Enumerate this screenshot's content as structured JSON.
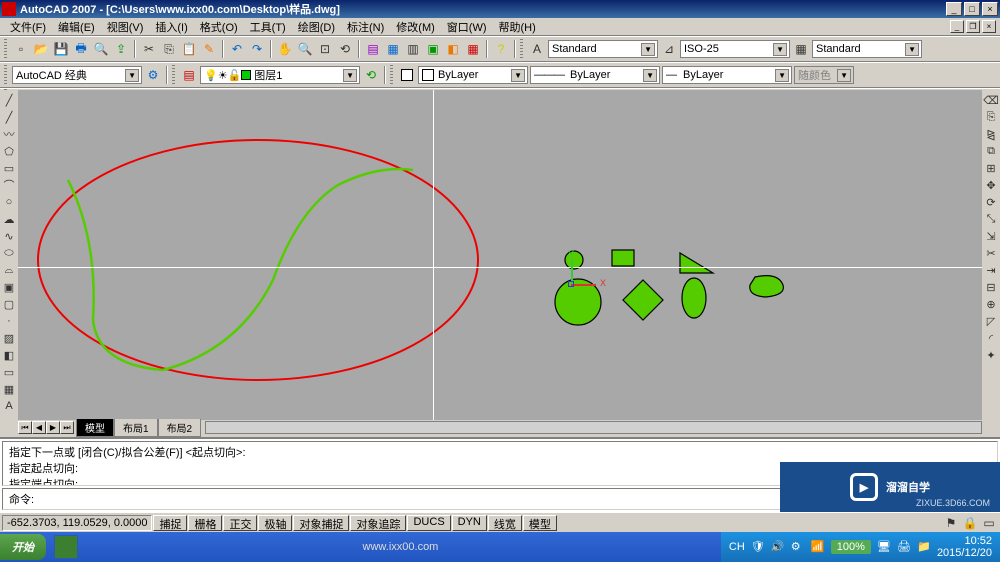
{
  "app": {
    "title": "AutoCAD 2007 - [C:\\Users\\www.ixx00.com\\Desktop\\样品.dwg]"
  },
  "menu": {
    "file": "文件(F)",
    "edit": "编辑(E)",
    "view": "视图(V)",
    "insert": "插入(I)",
    "format": "格式(O)",
    "tools": "工具(T)",
    "draw": "绘图(D)",
    "dimension": "标注(N)",
    "modify": "修改(M)",
    "window": "窗口(W)",
    "help": "帮助(H)"
  },
  "toolbar1": {
    "workspace": "AutoCAD 经典",
    "text_style": "Standard",
    "dim_style": "ISO-25",
    "table_style": "Standard"
  },
  "toolbar2": {
    "layer": "图层1",
    "color": "ByLayer",
    "linetype": "ByLayer",
    "lineweight": "ByLayer",
    "plotstyle": "随颜色"
  },
  "tabs": {
    "model": "模型",
    "layout1": "布局1",
    "layout2": "布局2"
  },
  "command": {
    "line1": "指定下一点或 [闭合(C)/拟合公差(F)] <起点切向>:",
    "line2": "指定起点切向:",
    "line3": "指定端点切向:",
    "prompt": "命令:"
  },
  "status": {
    "coords": "-652.3703, 119.0529, 0.0000",
    "snap": "捕捉",
    "grid": "栅格",
    "ortho": "正交",
    "polar": "极轴",
    "osnap": "对象捕捉",
    "otrack": "对象追踪",
    "ducs": "DUCS",
    "dyn": "DYN",
    "lwt": "线宽",
    "model": "模型"
  },
  "taskbar": {
    "start": "开始",
    "url": "www.ixx00.com",
    "lang": "CH",
    "zoom": "100%",
    "time": "10:52",
    "date": "2015/12/20"
  },
  "watermark": {
    "brand": "溜溜自学",
    "domain": "ZIXUE.3D66.COM"
  }
}
